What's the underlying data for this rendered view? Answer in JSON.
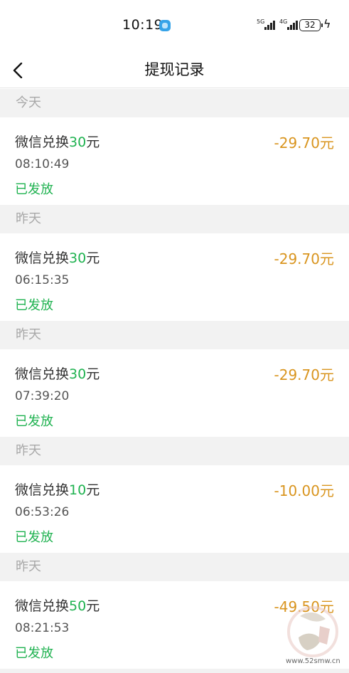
{
  "status_bar": {
    "time": "10:19",
    "network_1": "5G",
    "network_2": "4G",
    "battery": "32"
  },
  "nav": {
    "title": "提现记录"
  },
  "colors": {
    "amount_negative": "#d9951f",
    "status_green": "#1fb250",
    "section_bg": "#f2f2f2"
  },
  "sections": [
    {
      "day": "今天",
      "record": {
        "title_prefix": "微信兑换",
        "title_amount": "30",
        "title_suffix": "元",
        "time": "08:10:49",
        "status": "已发放",
        "amount": "-29.70元"
      }
    },
    {
      "day": "昨天",
      "record": {
        "title_prefix": "微信兑换",
        "title_amount": "30",
        "title_suffix": "元",
        "time": "06:15:35",
        "status": "已发放",
        "amount": "-29.70元"
      }
    },
    {
      "day": "昨天",
      "record": {
        "title_prefix": "微信兑换",
        "title_amount": "30",
        "title_suffix": "元",
        "time": "07:39:20",
        "status": "已发放",
        "amount": "-29.70元"
      }
    },
    {
      "day": "昨天",
      "record": {
        "title_prefix": "微信兑换",
        "title_amount": "10",
        "title_suffix": "元",
        "time": "06:53:26",
        "status": "已发放",
        "amount": "-10.00元"
      }
    },
    {
      "day": "昨天",
      "record": {
        "title_prefix": "微信兑换",
        "title_amount": "50",
        "title_suffix": "元",
        "time": "08:21:53",
        "status": "已发放",
        "amount": "-49.50元"
      }
    }
  ],
  "watermark": {
    "text": "www.52smw.cn"
  }
}
